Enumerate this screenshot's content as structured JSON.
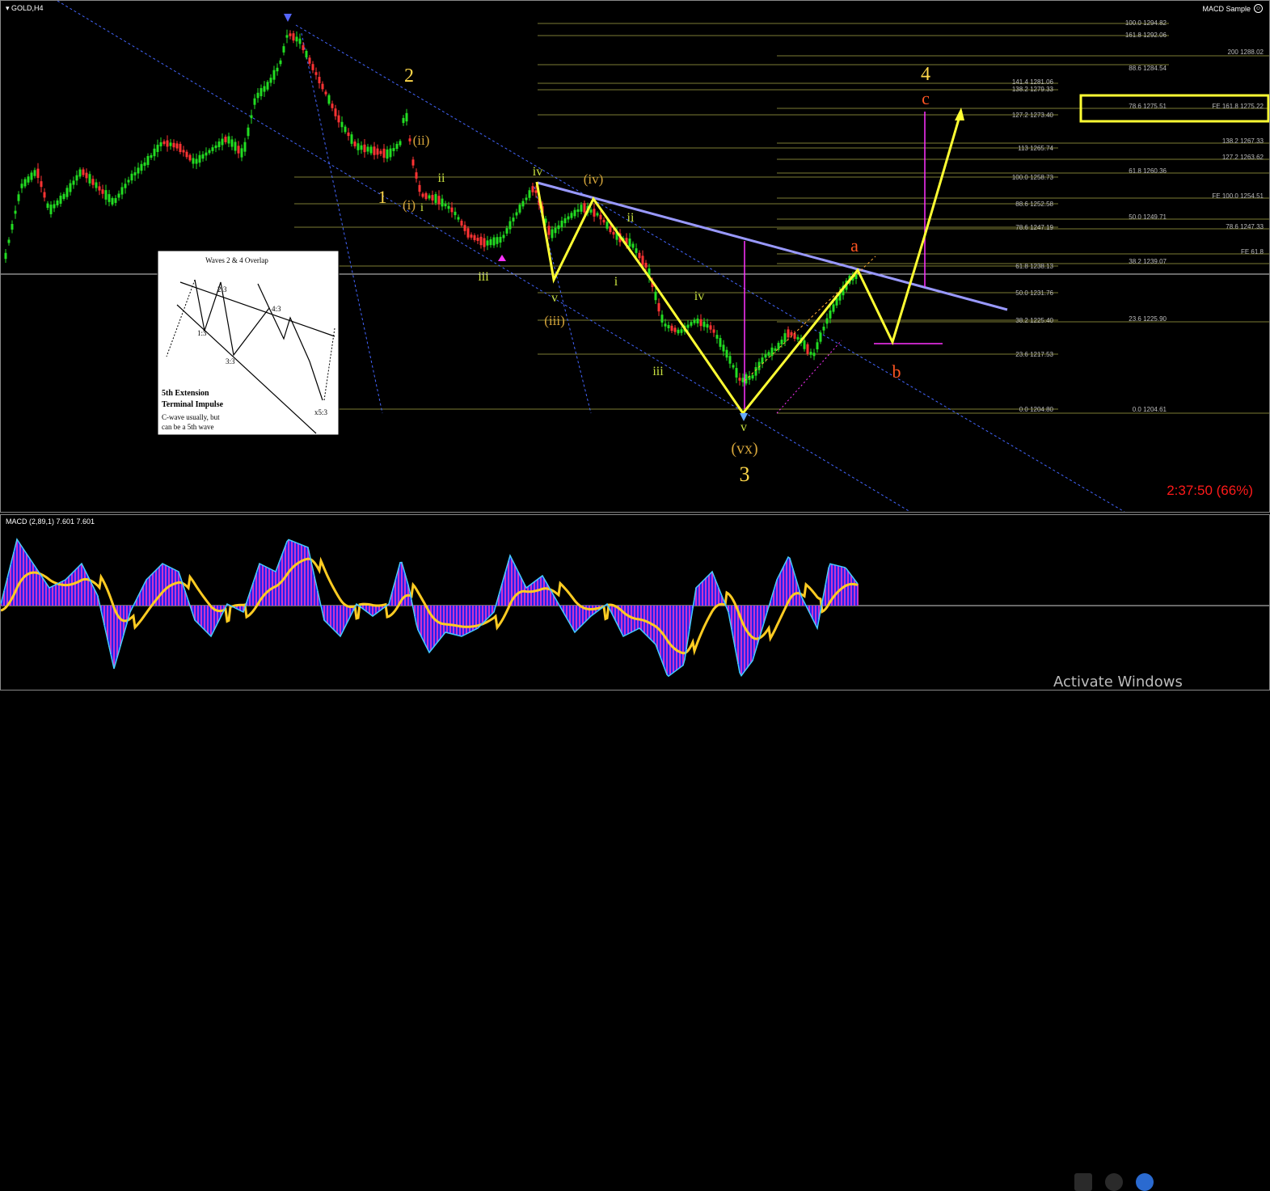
{
  "symbol_label": "GOLD,H4",
  "indicator_window_label": "MACD Sample",
  "macd_label": "MACD (2,89,1) 7.601 7.601",
  "countdown": "2:37:50 (66%)",
  "watermark": "Activate Windows",
  "colors": {
    "bull_candle": "#22dd22",
    "bear_candle": "#ff3333",
    "wave_line": "#ffff33",
    "trendline": "#9999ff",
    "channel": "#5577ff",
    "magenta": "#ff33ff",
    "fib": "#8a8a3a",
    "fib_text": "#b5b5b5"
  },
  "fib_left": [
    {
      "text": "100.0 1294.82"
    },
    {
      "text": "161.8 1292.06"
    },
    {
      "text": "88.6 1284.54"
    },
    {
      "text": "141.4 1281.06"
    },
    {
      "text": "138.2 1279.33"
    },
    {
      "text": "127.2 1273.40"
    },
    {
      "text": "113 1265.74"
    },
    {
      "text": "100.0 1258.73"
    },
    {
      "text": "88.6 1252.58"
    },
    {
      "text": "78.6 1247.19"
    },
    {
      "text": "61.8 1238.13"
    },
    {
      "text": "50.0 1231.76"
    },
    {
      "text": "38.2 1225.40"
    },
    {
      "text": "23.6 1217.53"
    },
    {
      "text": "0.0 1204.80"
    }
  ],
  "fib_right": [
    {
      "text": "200 1288.02"
    },
    {
      "text": "78.6 1275.51"
    },
    {
      "text": "FE 161.8 1275.22"
    },
    {
      "text": "138.2 1267.33"
    },
    {
      "text": "127.2 1263.62"
    },
    {
      "text": "61.8 1260.36"
    },
    {
      "text": "FE 100.0 1254.51"
    },
    {
      "text": "50.0 1249.71"
    },
    {
      "text": "78.6 1247.33"
    },
    {
      "text": "FE 61.8"
    },
    {
      "text": "38.2 1239.07"
    },
    {
      "text": "23.6 1225.90"
    },
    {
      "text": "0.0 1204.61"
    }
  ],
  "wave_labels": {
    "w2": "2",
    "wii_paren": "(ii)",
    "w1": "1",
    "wi_paren": "(i)",
    "wii": "ii",
    "wi": "i",
    "wiii_1": "iii",
    "wiv": "iv",
    "wiv_paren": "(iv)",
    "wii_2": "ii",
    "wv": "v",
    "wiii_paren": "(iii)",
    "wi_2": "i",
    "wiv_2": "iv",
    "wiii_2": "iii",
    "wv_2": "v",
    "wvx": "(vx)",
    "w3": "3",
    "wa": "a",
    "wb": "b",
    "wc": "c",
    "w4": "4"
  },
  "inset": {
    "title": "Waves 2 & 4 Overlap",
    "l1": "1:3",
    "l2": "2:3",
    "l3": "3:3",
    "l4": "4:3",
    "l5": "x5:3",
    "heading1": "5th Extension",
    "heading2": "Terminal Impulse",
    "note1": "C-wave usually, but",
    "note2": "can be a 5th wave"
  }
}
